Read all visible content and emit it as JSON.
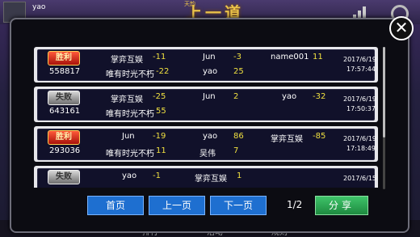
{
  "background": {
    "username": "yao",
    "title": "上一道",
    "title_small": "天韵",
    "nav": [
      "排行",
      "活动",
      "规则"
    ]
  },
  "close_glyph": "✕",
  "records": [
    {
      "result": "胜利",
      "room_id": "558817",
      "players": [
        {
          "name": "掌弈互娱",
          "score": "-11"
        },
        {
          "name": "Jun",
          "score": "-3"
        },
        {
          "name": "name001",
          "score": "11"
        },
        {
          "name": "唯有时光不朽",
          "score": "-22"
        },
        {
          "name": "yao",
          "score": "25"
        }
      ],
      "date": "2017/6/19",
      "time": "17:57:44"
    },
    {
      "result": "失败",
      "room_id": "643161",
      "players": [
        {
          "name": "掌弈互娱",
          "score": "-25"
        },
        {
          "name": "Jun",
          "score": "2"
        },
        {
          "name": "yao",
          "score": "-32"
        },
        {
          "name": "唯有时光不朽",
          "score": "55"
        }
      ],
      "date": "2017/6/19",
      "time": "17:50:37"
    },
    {
      "result": "胜利",
      "room_id": "293036",
      "players": [
        {
          "name": "Jun",
          "score": "-19"
        },
        {
          "name": "yao",
          "score": "86"
        },
        {
          "name": "掌弈互娱",
          "score": "-85"
        },
        {
          "name": "唯有时光不朽",
          "score": "11"
        },
        {
          "name": "吴伟",
          "score": "7"
        }
      ],
      "date": "2017/6/19",
      "time": "17:18:49"
    },
    {
      "result": "失败",
      "room_id": "",
      "players": [
        {
          "name": "yao",
          "score": "-1"
        },
        {
          "name": "掌弈互娱",
          "score": "1"
        }
      ],
      "date": "2017/6/15",
      "time": ""
    }
  ],
  "pagination": {
    "first": "首页",
    "prev": "上一页",
    "next": "下一页",
    "page": "1/2"
  },
  "share_label": "分享",
  "colors": {
    "score": "#f0e040",
    "button": "#1e6fd0",
    "share": "#2faa55",
    "win_badge": "#c8241a",
    "lose_badge": "#9a9a9a"
  }
}
